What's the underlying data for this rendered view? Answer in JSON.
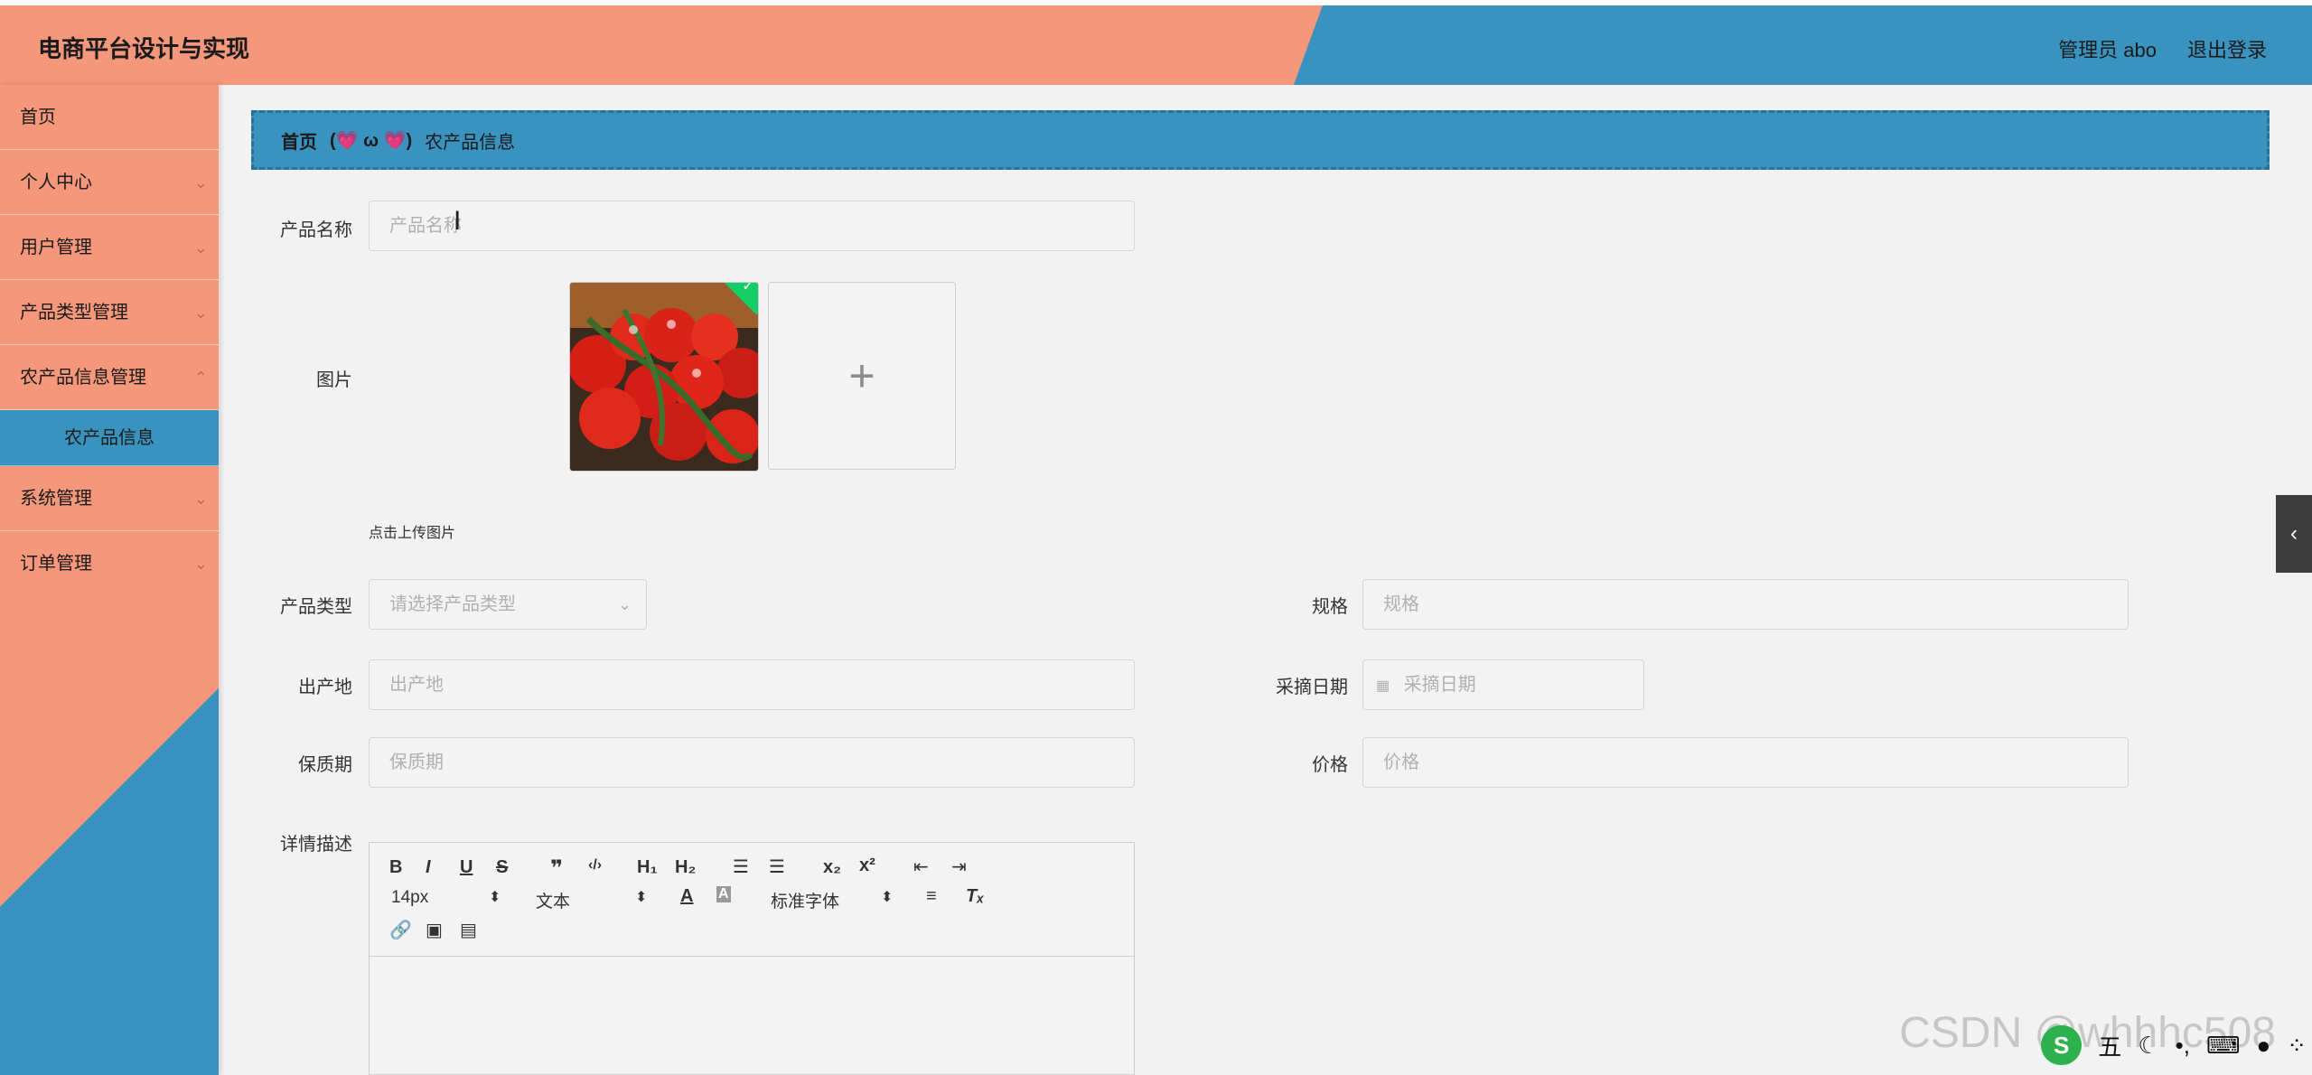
{
  "header": {
    "app_title": "电商平台设计与实现",
    "user_label": "管理员 abo",
    "logout_label": "退出登录"
  },
  "sidebar": {
    "items": [
      {
        "label": "首页"
      },
      {
        "label": "个人中心"
      },
      {
        "label": "用户管理"
      },
      {
        "label": "产品类型管理"
      },
      {
        "label": "农产品信息管理"
      },
      {
        "label": "农产品信息"
      },
      {
        "label": "系统管理"
      },
      {
        "label": "订单管理"
      }
    ]
  },
  "breadcrumb": {
    "home": "首页",
    "separator": "(💗 ω 💗)",
    "current": "农产品信息"
  },
  "form": {
    "product_name": {
      "label": "产品名称",
      "placeholder": "产品名称"
    },
    "image": {
      "label": "图片",
      "upload_tip": "点击上传图片",
      "add_symbol": "+"
    },
    "product_type": {
      "label": "产品类型",
      "placeholder": "请选择产品类型"
    },
    "spec": {
      "label": "规格",
      "placeholder": "规格"
    },
    "origin": {
      "label": "出产地",
      "placeholder": "出产地"
    },
    "pick_date": {
      "label": "采摘日期",
      "placeholder": "采摘日期"
    },
    "shelf_life": {
      "label": "保质期",
      "placeholder": "保质期"
    },
    "price": {
      "label": "价格",
      "placeholder": "价格"
    },
    "detail": {
      "label": "详情描述"
    }
  },
  "editor": {
    "font_size": "14px",
    "block_type": "文本",
    "font_family": "标准字体"
  },
  "watermark": "CSDN @whhhc508",
  "ime": {
    "logo": "S",
    "mode": "五"
  }
}
